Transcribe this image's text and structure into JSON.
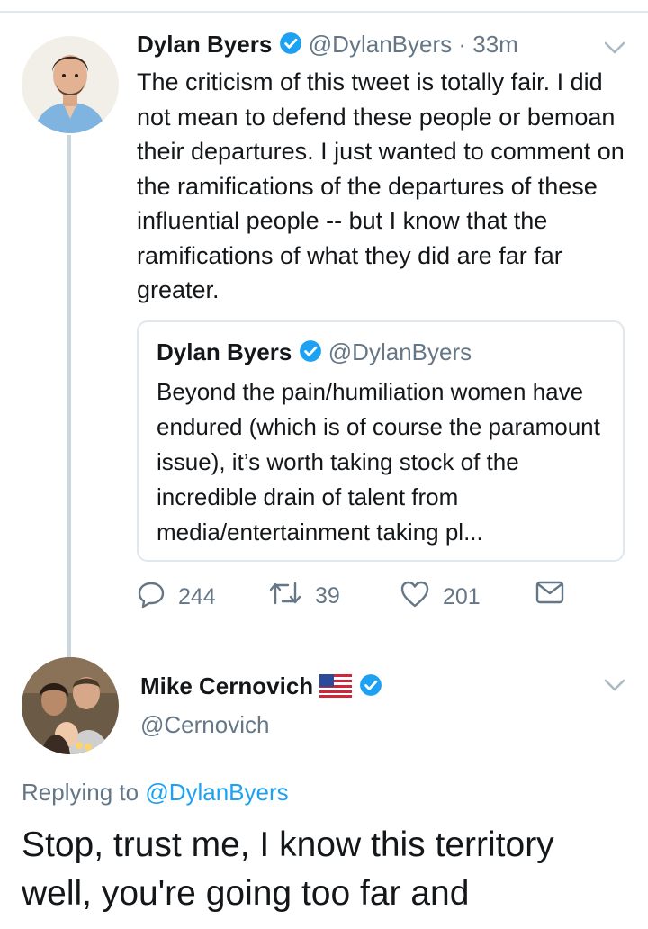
{
  "tweet": {
    "author_name": "Dylan Byers",
    "author_handle": "@DylanByers",
    "separator": "·",
    "time": "33m",
    "text": "The criticism of this tweet is totally fair. I did not mean to defend these people or bemoan their departures. I just wanted to comment on the ramifications of the departures of these influential people -- but I know that the ramifications of what they did are far far greater.",
    "quoted": {
      "author_name": "Dylan Byers",
      "author_handle": "@DylanByers",
      "text": "Beyond the pain/humiliation women have endured (which is of course the paramount issue), it’s worth taking stock of the incredible drain of talent from media/entertainment taking pl..."
    },
    "actions": {
      "reply_count": "244",
      "retweet_count": "39",
      "like_count": "201"
    }
  },
  "reply": {
    "author_name": "Mike Cernovich",
    "flag": "🇺🇸",
    "author_handle": "@Cernovich",
    "replying_prefix": "Replying to",
    "replying_to": "@DylanByers",
    "text": "Stop, trust me, I know this territory well, you're going too far and"
  },
  "colors": {
    "verified": "#1da1f2",
    "secondary_text": "#657786",
    "link": "#1da1f2",
    "border": "#e1e8ed"
  },
  "icons": [
    "verified-badge-icon",
    "chevron-down-icon",
    "reply-icon",
    "retweet-icon",
    "like-icon",
    "direct-message-icon",
    "us-flag-icon"
  ]
}
